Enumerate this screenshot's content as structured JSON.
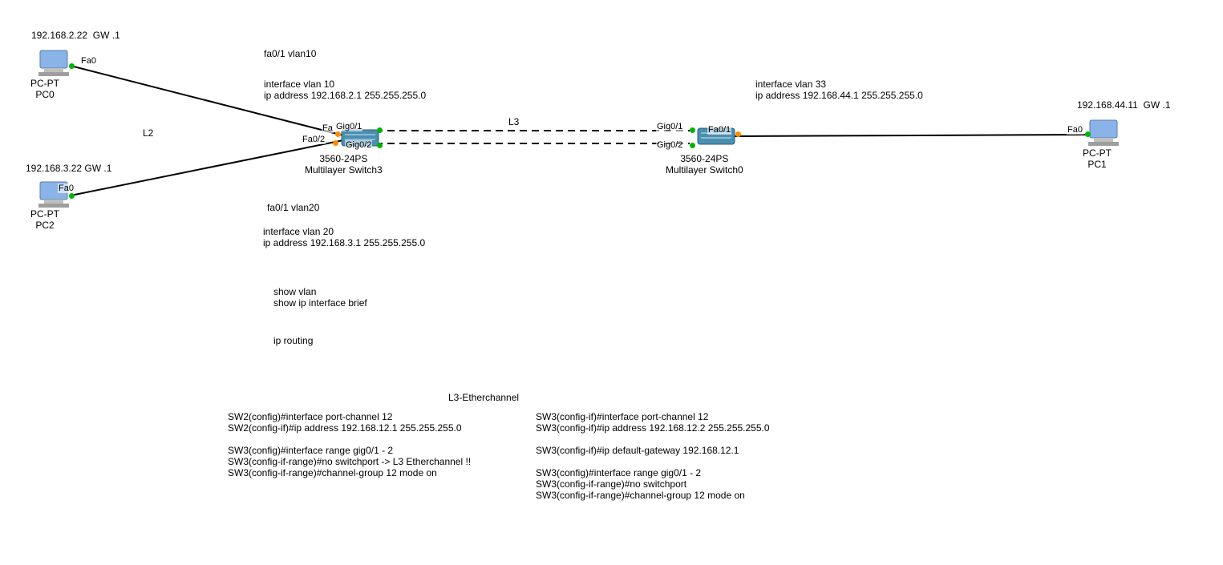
{
  "pc0": {
    "ip": "192.168.2.22  GW .1",
    "type": "PC-PT",
    "name": "PC0",
    "port": "Fa0"
  },
  "pc2": {
    "ip": "192.168.3.22 GW .1",
    "type": "PC-PT",
    "name": "PC2",
    "port": "Fa0"
  },
  "pc1": {
    "ip": "192.168.44.11  GW .1",
    "type": "PC-PT",
    "name": "PC1",
    "port": "Fa0"
  },
  "sw3": {
    "model": "3560-24PS",
    "name": "Multilayer Switch3",
    "ports": {
      "fa01": "Fa",
      "fa02": "Fa0/2",
      "g01": "Gig0/1",
      "g02": "Gig0/2"
    }
  },
  "sw0": {
    "model": "3560-24PS",
    "name": "Multilayer Switch0",
    "ports": {
      "fa01": "Fa0/1",
      "g01": "Gig0/1",
      "g02": "Gig0/2"
    }
  },
  "notes": {
    "l2": "L2",
    "l3": "L3",
    "vlan10_line": "fa0/1 vlan10",
    "vlan10_cfg": "interface vlan 10\nip address 192.168.2.1 255.255.255.0",
    "vlan33_cfg": "interface vlan 33\nip address 192.168.44.1 255.255.255.0",
    "vlan20_line": "fa0/1 vlan20",
    "vlan20_cfg": "interface vlan 20\nip address 192.168.3.1 255.255.255.0",
    "show_cmds": "show vlan\nshow ip interface brief",
    "iprouting": "ip routing",
    "ether_title": "L3-Etherchannel",
    "ether_left": "SW2(config)#interface port-channel 12\nSW2(config-if)#ip address 192.168.12.1 255.255.255.0\n\nSW3(config)#interface range gig0/1 - 2\nSW3(config-if-range)#no switchport -> L3 Etherchannel !!\nSW3(config-if-range)#channel-group 12 mode on",
    "ether_right": "SW3(config-if)#interface port-channel 12\nSW3(config-if)#ip address 192.168.12.2 255.255.255.0\n\nSW3(config-if)#ip default-gateway 192.168.12.1\n\nSW3(config)#interface range gig0/1 - 2\nSW3(config-if-range)#no switchport\nSW3(config-if-range)#channel-group 12 mode on"
  }
}
